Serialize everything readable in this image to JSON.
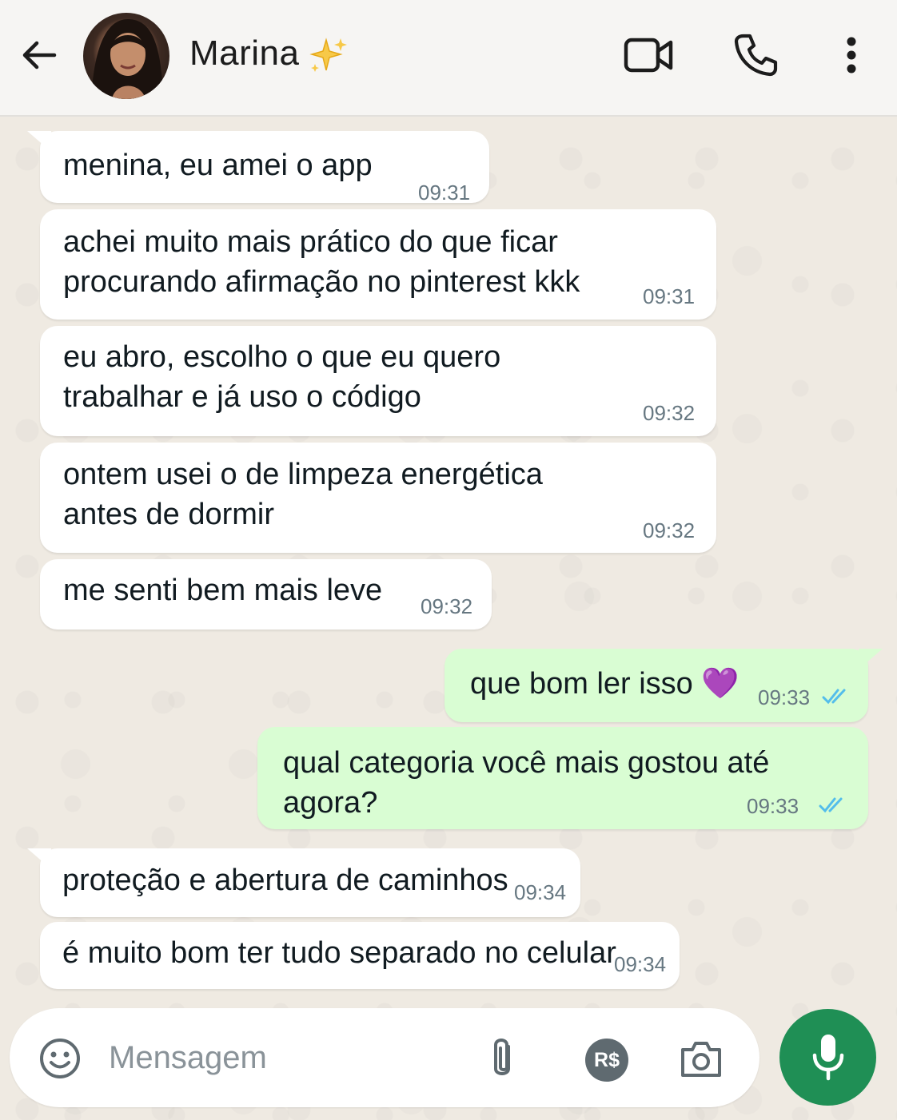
{
  "header": {
    "contact_name": "Marina",
    "icons": [
      "back-arrow-icon",
      "sparkles-icon",
      "video-call-icon",
      "phone-icon",
      "more-options-icon"
    ]
  },
  "messages": [
    {
      "dir": "in",
      "text": "menina, eu amei o app",
      "time": "09:31"
    },
    {
      "dir": "in",
      "text": "achei muito mais prático do que ficar\nprocurando afirmação no pinterest kkk",
      "time": "09:31"
    },
    {
      "dir": "in",
      "text": "eu abro, escolho o que eu quero\ntrabalhar e já uso o código",
      "time": "09:32"
    },
    {
      "dir": "in",
      "text": "ontem usei o de limpeza energética\nantes de dormir",
      "time": "09:32"
    },
    {
      "dir": "in",
      "text": "me senti bem mais leve",
      "time": "09:32"
    },
    {
      "dir": "out",
      "text": "que bom ler isso 💜",
      "time": "09:33",
      "status": "read"
    },
    {
      "dir": "out",
      "text": "qual categoria você mais gostou até agora?",
      "time": "09:33",
      "status": "read"
    },
    {
      "dir": "in",
      "text": "proteção e abertura de caminhos",
      "time": "09:34"
    },
    {
      "dir": "in",
      "text": "é muito bom ter tudo separado no celular",
      "time": "09:34"
    }
  ],
  "composer": {
    "placeholder": "Mensagem",
    "payment_label": "R$",
    "icons": [
      "emoji-icon",
      "attach-clip-icon",
      "payment-icon",
      "camera-icon",
      "microphone-icon"
    ]
  },
  "colors": {
    "chat_bg": "#efeae2",
    "incoming": "#ffffff",
    "outgoing": "#d9fdd3",
    "read_ticks": "#53bdeb",
    "mic_button": "#1f8f55"
  }
}
